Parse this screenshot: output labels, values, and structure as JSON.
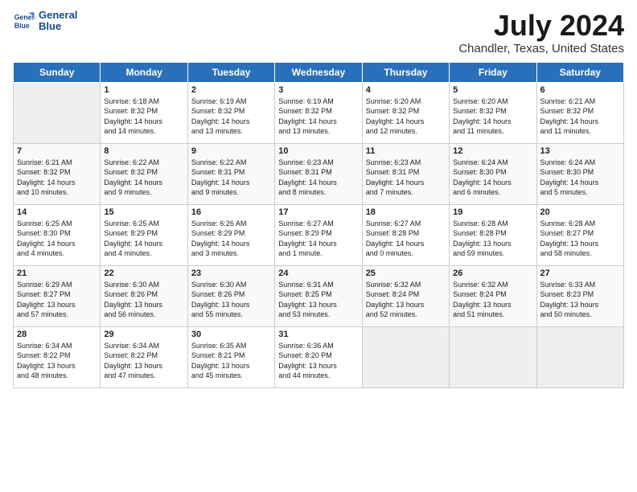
{
  "logo": {
    "line1": "General",
    "line2": "Blue"
  },
  "title": "July 2024",
  "subtitle": "Chandler, Texas, United States",
  "headers": [
    "Sunday",
    "Monday",
    "Tuesday",
    "Wednesday",
    "Thursday",
    "Friday",
    "Saturday"
  ],
  "weeks": [
    [
      {
        "day": "",
        "content": ""
      },
      {
        "day": "1",
        "content": "Sunrise: 6:18 AM\nSunset: 8:32 PM\nDaylight: 14 hours\nand 14 minutes."
      },
      {
        "day": "2",
        "content": "Sunrise: 6:19 AM\nSunset: 8:32 PM\nDaylight: 14 hours\nand 13 minutes."
      },
      {
        "day": "3",
        "content": "Sunrise: 6:19 AM\nSunset: 8:32 PM\nDaylight: 14 hours\nand 13 minutes."
      },
      {
        "day": "4",
        "content": "Sunrise: 6:20 AM\nSunset: 8:32 PM\nDaylight: 14 hours\nand 12 minutes."
      },
      {
        "day": "5",
        "content": "Sunrise: 6:20 AM\nSunset: 8:32 PM\nDaylight: 14 hours\nand 11 minutes."
      },
      {
        "day": "6",
        "content": "Sunrise: 6:21 AM\nSunset: 8:32 PM\nDaylight: 14 hours\nand 11 minutes."
      }
    ],
    [
      {
        "day": "7",
        "content": "Sunrise: 6:21 AM\nSunset: 8:32 PM\nDaylight: 14 hours\nand 10 minutes."
      },
      {
        "day": "8",
        "content": "Sunrise: 6:22 AM\nSunset: 8:32 PM\nDaylight: 14 hours\nand 9 minutes."
      },
      {
        "day": "9",
        "content": "Sunrise: 6:22 AM\nSunset: 8:31 PM\nDaylight: 14 hours\nand 9 minutes."
      },
      {
        "day": "10",
        "content": "Sunrise: 6:23 AM\nSunset: 8:31 PM\nDaylight: 14 hours\nand 8 minutes."
      },
      {
        "day": "11",
        "content": "Sunrise: 6:23 AM\nSunset: 8:31 PM\nDaylight: 14 hours\nand 7 minutes."
      },
      {
        "day": "12",
        "content": "Sunrise: 6:24 AM\nSunset: 8:30 PM\nDaylight: 14 hours\nand 6 minutes."
      },
      {
        "day": "13",
        "content": "Sunrise: 6:24 AM\nSunset: 8:30 PM\nDaylight: 14 hours\nand 5 minutes."
      }
    ],
    [
      {
        "day": "14",
        "content": "Sunrise: 6:25 AM\nSunset: 8:30 PM\nDaylight: 14 hours\nand 4 minutes."
      },
      {
        "day": "15",
        "content": "Sunrise: 6:25 AM\nSunset: 8:29 PM\nDaylight: 14 hours\nand 4 minutes."
      },
      {
        "day": "16",
        "content": "Sunrise: 6:26 AM\nSunset: 8:29 PM\nDaylight: 14 hours\nand 3 minutes."
      },
      {
        "day": "17",
        "content": "Sunrise: 6:27 AM\nSunset: 8:29 PM\nDaylight: 14 hours\nand 1 minute."
      },
      {
        "day": "18",
        "content": "Sunrise: 6:27 AM\nSunset: 8:28 PM\nDaylight: 14 hours\nand 0 minutes."
      },
      {
        "day": "19",
        "content": "Sunrise: 6:28 AM\nSunset: 8:28 PM\nDaylight: 13 hours\nand 59 minutes."
      },
      {
        "day": "20",
        "content": "Sunrise: 6:28 AM\nSunset: 8:27 PM\nDaylight: 13 hours\nand 58 minutes."
      }
    ],
    [
      {
        "day": "21",
        "content": "Sunrise: 6:29 AM\nSunset: 8:27 PM\nDaylight: 13 hours\nand 57 minutes."
      },
      {
        "day": "22",
        "content": "Sunrise: 6:30 AM\nSunset: 8:26 PM\nDaylight: 13 hours\nand 56 minutes."
      },
      {
        "day": "23",
        "content": "Sunrise: 6:30 AM\nSunset: 8:26 PM\nDaylight: 13 hours\nand 55 minutes."
      },
      {
        "day": "24",
        "content": "Sunrise: 6:31 AM\nSunset: 8:25 PM\nDaylight: 13 hours\nand 53 minutes."
      },
      {
        "day": "25",
        "content": "Sunrise: 6:32 AM\nSunset: 8:24 PM\nDaylight: 13 hours\nand 52 minutes."
      },
      {
        "day": "26",
        "content": "Sunrise: 6:32 AM\nSunset: 8:24 PM\nDaylight: 13 hours\nand 51 minutes."
      },
      {
        "day": "27",
        "content": "Sunrise: 6:33 AM\nSunset: 8:23 PM\nDaylight: 13 hours\nand 50 minutes."
      }
    ],
    [
      {
        "day": "28",
        "content": "Sunrise: 6:34 AM\nSunset: 8:22 PM\nDaylight: 13 hours\nand 48 minutes."
      },
      {
        "day": "29",
        "content": "Sunrise: 6:34 AM\nSunset: 8:22 PM\nDaylight: 13 hours\nand 47 minutes."
      },
      {
        "day": "30",
        "content": "Sunrise: 6:35 AM\nSunset: 8:21 PM\nDaylight: 13 hours\nand 45 minutes."
      },
      {
        "day": "31",
        "content": "Sunrise: 6:36 AM\nSunset: 8:20 PM\nDaylight: 13 hours\nand 44 minutes."
      },
      {
        "day": "",
        "content": ""
      },
      {
        "day": "",
        "content": ""
      },
      {
        "day": "",
        "content": ""
      }
    ]
  ]
}
